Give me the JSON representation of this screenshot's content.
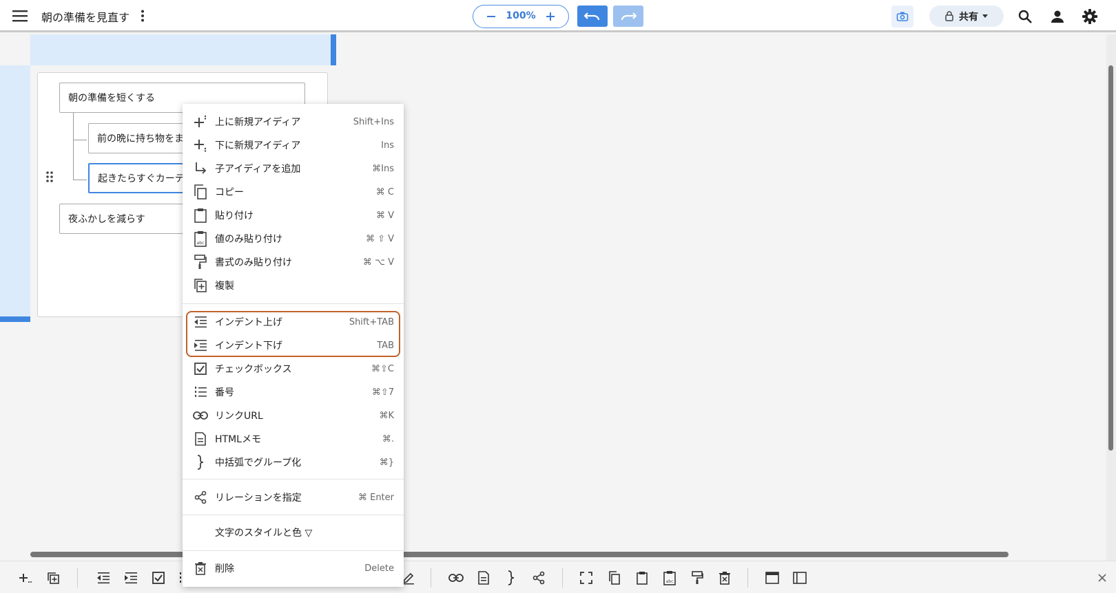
{
  "header": {
    "title": "朝の準備を見直す",
    "zoom": "100%",
    "share_label": "共有"
  },
  "mindmap": {
    "nodes": [
      {
        "label": "朝の準備を短くする"
      },
      {
        "label": "前の晩に持ち物をま"
      },
      {
        "label": "起きたらすぐカーテ"
      },
      {
        "label": "夜ふかしを減らす"
      }
    ]
  },
  "context_menu": {
    "items": [
      {
        "label": "上に新規アイディア",
        "shortcut": "Shift+Ins",
        "icon": "insert-above-icon"
      },
      {
        "label": "下に新規アイディア",
        "shortcut": "Ins",
        "icon": "insert-below-icon"
      },
      {
        "label": "子アイディアを追加",
        "shortcut": "⌘Ins",
        "icon": "add-child-icon"
      },
      {
        "label": "コピー",
        "shortcut": "⌘ C",
        "icon": "copy-icon"
      },
      {
        "label": "貼り付け",
        "shortcut": "⌘ V",
        "icon": "paste-icon"
      },
      {
        "label": "値のみ貼り付け",
        "shortcut": "⌘ ⇧ V",
        "icon": "paste-value-icon"
      },
      {
        "label": "書式のみ貼り付け",
        "shortcut": "⌘ ⌥ V",
        "icon": "paste-format-icon"
      },
      {
        "label": "複製",
        "shortcut": "",
        "icon": "duplicate-icon"
      },
      {
        "label": "インデント上げ",
        "shortcut": "Shift+TAB",
        "icon": "outdent-icon"
      },
      {
        "label": "インデント下げ",
        "shortcut": "TAB",
        "icon": "indent-icon"
      },
      {
        "label": "チェックボックス",
        "shortcut": "⌘⇧C",
        "icon": "checkbox-icon"
      },
      {
        "label": "番号",
        "shortcut": "⌘⇧7",
        "icon": "numbered-list-icon"
      },
      {
        "label": "リンクURL",
        "shortcut": "⌘K",
        "icon": "link-icon"
      },
      {
        "label": "HTMLメモ",
        "shortcut": "⌘.",
        "icon": "note-icon"
      },
      {
        "label": "中括弧でグループ化",
        "shortcut": "⌘}",
        "icon": "brace-icon"
      },
      {
        "label": "リレーションを指定",
        "shortcut": "⌘ Enter",
        "icon": "relation-icon"
      },
      {
        "label": "文字のスタイルと色 ▽",
        "shortcut": "",
        "icon": ""
      },
      {
        "label": "削除",
        "shortcut": "Delete",
        "icon": "delete-icon"
      }
    ]
  },
  "colors": {
    "accent": "#3f86e0",
    "highlight_border": "#c0622a",
    "selection_bg": "#dcebfb"
  }
}
